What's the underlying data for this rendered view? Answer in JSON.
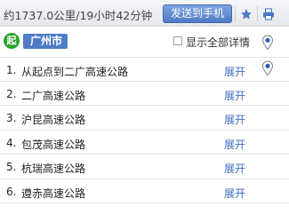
{
  "header": {
    "summary": "约1737.0公里/19小时42分钟",
    "send_button": "发送到手机",
    "favorite_icon": "star-icon",
    "print_icon": "printer-icon"
  },
  "origin": {
    "badge": "起",
    "city": "广州市",
    "show_all_label": "显示全部详情",
    "show_all_checked": false
  },
  "steps": [
    {
      "index": "1.",
      "road": "从起点到二广高速公路",
      "action": "展开",
      "has_pin": true
    },
    {
      "index": "2.",
      "road": "二广高速公路",
      "action": "展开",
      "has_pin": false
    },
    {
      "index": "3.",
      "road": "沪昆高速公路",
      "action": "展开",
      "has_pin": false
    },
    {
      "index": "4.",
      "road": "包茂高速公路",
      "action": "展开",
      "has_pin": false
    },
    {
      "index": "5.",
      "road": "杭瑞高速公路",
      "action": "展开",
      "has_pin": false
    },
    {
      "index": "6.",
      "road": "遵赤高速公路",
      "action": "展开",
      "has_pin": false
    }
  ],
  "colors": {
    "accent": "#4f7cc6",
    "origin_green": "#2aa52a",
    "link": "#3d6bc2"
  }
}
